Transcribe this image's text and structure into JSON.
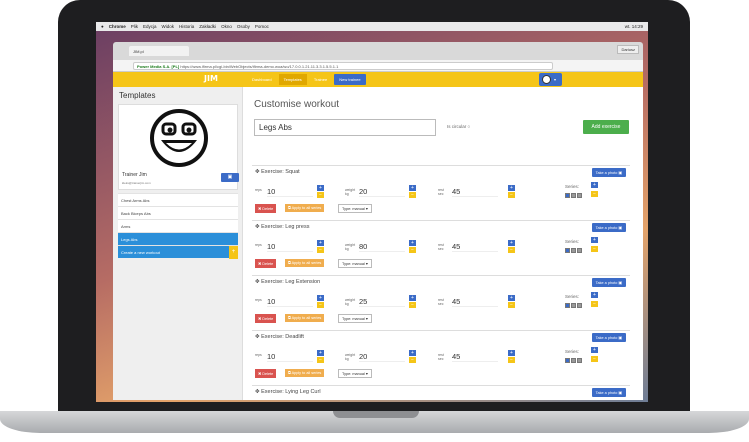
{
  "menubar": {
    "apple": "",
    "app": "Chrome",
    "items": [
      "Plik",
      "Edycja",
      "Widok",
      "Historia",
      "Zakładki",
      "Okno",
      "Osoby",
      "Pomoc"
    ],
    "clock": "wt. 14:29"
  },
  "browser": {
    "tab_title": "JIM.pl",
    "user_chip": "Dariusz",
    "url_secure": "Power Media S.A. [PL]",
    "url_path": "https://www.ifirma.pl/cgi-bin/WebObjects/ifirma-demo.woa/wo/17.0.0.1.21.11.3.3.1.5.5.1.1"
  },
  "nav": {
    "logo": "JIM",
    "items": [
      {
        "label": "Dashboard"
      },
      {
        "label": "Templates"
      },
      {
        "label": "Trainee"
      },
      {
        "label": "New trainee"
      }
    ],
    "active": "Templates"
  },
  "sidebar": {
    "heading": "Templates",
    "profile": {
      "name": "Trainer Jim",
      "email": "kleks@trainerjim.com"
    },
    "items": [
      {
        "label": "Chest Arms Abs"
      },
      {
        "label": "Back Biceps Abs"
      },
      {
        "label": "Arms"
      },
      {
        "label": "Legs Abs"
      },
      {
        "label": "Create a new workout"
      }
    ],
    "active": "Legs Abs"
  },
  "main": {
    "title": "Customise workout",
    "workout_name": "Legs Abs",
    "circular_label": "Is circular",
    "add_button": "Add exercise",
    "photo_button": "Take a photo",
    "reps_label": "reps",
    "weight_label": "weight kg",
    "rest_label": "rest sec",
    "series_label": "Series:",
    "delete_label": "Delete",
    "apply_label": "Apply to all series",
    "type_label": "Type: manual",
    "exercises": [
      {
        "name": "Exercise: Squat",
        "reps": "10",
        "weight": "20",
        "rest": "45"
      },
      {
        "name": "Exercise: Leg press",
        "reps": "10",
        "weight": "80",
        "rest": "45"
      },
      {
        "name": "Exercise: Leg Extension",
        "reps": "10",
        "weight": "25",
        "rest": "45"
      },
      {
        "name": "Exercise: Deadlift",
        "reps": "10",
        "weight": "20",
        "rest": "45"
      },
      {
        "name": "Exercise: Lying Leg Curl"
      }
    ]
  },
  "colors": {
    "accent": "#f5c518",
    "primary": "#3b6bc7",
    "success": "#4cae4c",
    "danger": "#d9534f",
    "warning": "#f0ad4e",
    "active_item": "#2b8fd9"
  }
}
